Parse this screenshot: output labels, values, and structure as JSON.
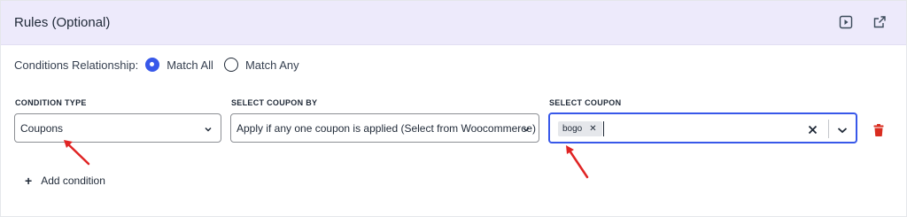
{
  "header": {
    "title": "Rules (Optional)",
    "icons": [
      "play-icon",
      "external-link-icon"
    ]
  },
  "relationship": {
    "label": "Conditions Relationship:",
    "options": [
      {
        "label": "Match All",
        "selected": true
      },
      {
        "label": "Match Any",
        "selected": false
      }
    ]
  },
  "condition": {
    "type_label": "CONDITION TYPE",
    "type_value": "Coupons",
    "select_by_label": "SELECT COUPON BY",
    "select_by_value": "Apply if any one coupon is applied (Select from Woocommerce)",
    "coupon_label": "SELECT COUPON",
    "coupon_tags": [
      "bogo"
    ],
    "coupon_input_value": ""
  },
  "add_condition_label": "Add condition",
  "colors": {
    "accent": "#3858e9",
    "header_bg": "#edeafb",
    "delete": "#d92d20",
    "annotation_arrow": "#e02424"
  }
}
